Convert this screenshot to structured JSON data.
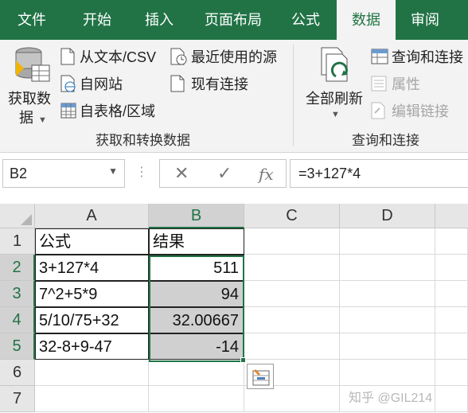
{
  "tabs": [
    "文件",
    "开始",
    "插入",
    "页面布局",
    "公式",
    "数据",
    "审阅"
  ],
  "active_tab": "数据",
  "ribbon": {
    "get_data": {
      "label_line1": "获取数",
      "label_line2": "据",
      "icon": "database-icon"
    },
    "from_text_csv": {
      "label": "从文本/CSV",
      "icon": "document-icon"
    },
    "from_web": {
      "label": "自网站",
      "icon": "web-page-icon"
    },
    "from_table": {
      "label": "自表格/区域",
      "icon": "table-icon"
    },
    "recent_sources": {
      "label": "最近使用的源",
      "icon": "clock-document-icon"
    },
    "existing_connections": {
      "label": "现有连接",
      "icon": "document-icon"
    },
    "group1_label": "获取和转换数据",
    "refresh_all": {
      "label": "全部刷新",
      "icon": "refresh-icon"
    },
    "queries_connections": {
      "label": "查询和连接",
      "icon": "table-icon"
    },
    "properties": {
      "label": "属性",
      "icon": "properties-icon"
    },
    "edit_links": {
      "label": "编辑链接",
      "icon": "link-icon"
    },
    "group2_label": "查询和连接"
  },
  "formula_bar": {
    "name_box": "B2",
    "cancel_icon": "✕",
    "enter_icon": "✓",
    "fx_label": "fx",
    "formula": "=3+127*4"
  },
  "grid": {
    "columns": [
      "A",
      "B",
      "C",
      "D"
    ],
    "rows": [
      "1",
      "2",
      "3",
      "4",
      "5",
      "6",
      "7"
    ],
    "header": {
      "A": "公式",
      "B": "结果"
    },
    "data": [
      {
        "A": "3+127*4",
        "B": "511"
      },
      {
        "A": "7^2+5*9",
        "B": "94"
      },
      {
        "A": "5/10/75+32",
        "B": "32.00667"
      },
      {
        "A": "32-8+9-47",
        "B": "-14"
      }
    ],
    "selected_range": "B2:B5",
    "active_cell": "B2"
  },
  "colors": {
    "excel_green": "#217346",
    "selection_gray": "#d0d0d0"
  },
  "watermark": "知乎 @GIL214"
}
